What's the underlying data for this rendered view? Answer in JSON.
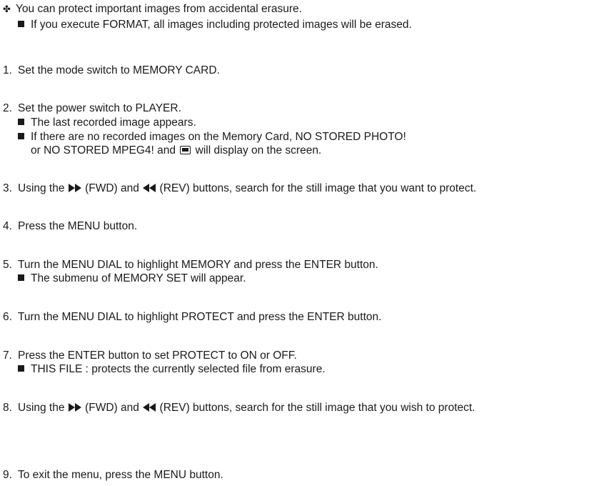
{
  "intro": {
    "bullet": "You can protect important images from accidental erasure.",
    "note": "If you execute FORMAT, all images including protected images will be erased."
  },
  "steps": [
    {
      "num": "1.",
      "text": "Set the mode switch to MEMORY CARD."
    },
    {
      "num": "2.",
      "text": "Set the power switch to PLAYER.",
      "notes": [
        "The last recorded image appears.",
        "If there are no recorded images on the Memory Card, NO STORED PHOTO!"
      ],
      "cont_pre": "or NO STORED MPEG4! and",
      "cont_post": "will display on the screen."
    },
    {
      "num": "3.",
      "pre": "Using the",
      "mid": "(FWD) and",
      "post": "(REV) buttons, search for the still image that you want to protect."
    },
    {
      "num": "4.",
      "text": "Press the MENU button."
    },
    {
      "num": "5.",
      "text": "Turn the MENU DIAL to highlight MEMORY and press the ENTER button.",
      "notes": [
        "The submenu of MEMORY SET will appear."
      ]
    },
    {
      "num": "6.",
      "text": "Turn the MENU DIAL to highlight PROTECT and press the ENTER button."
    },
    {
      "num": "7.",
      "text": "Press the ENTER button to set PROTECT to ON or OFF.",
      "notes": [
        "THIS FILE : protects the currently selected file from erasure."
      ]
    },
    {
      "num": "8.",
      "pre": "Using the",
      "mid": "(FWD) and",
      "post": "(REV) buttons, search for the still image that you wish to protect."
    },
    {
      "num": "9.",
      "text": "To exit the menu, press the MENU button."
    }
  ]
}
